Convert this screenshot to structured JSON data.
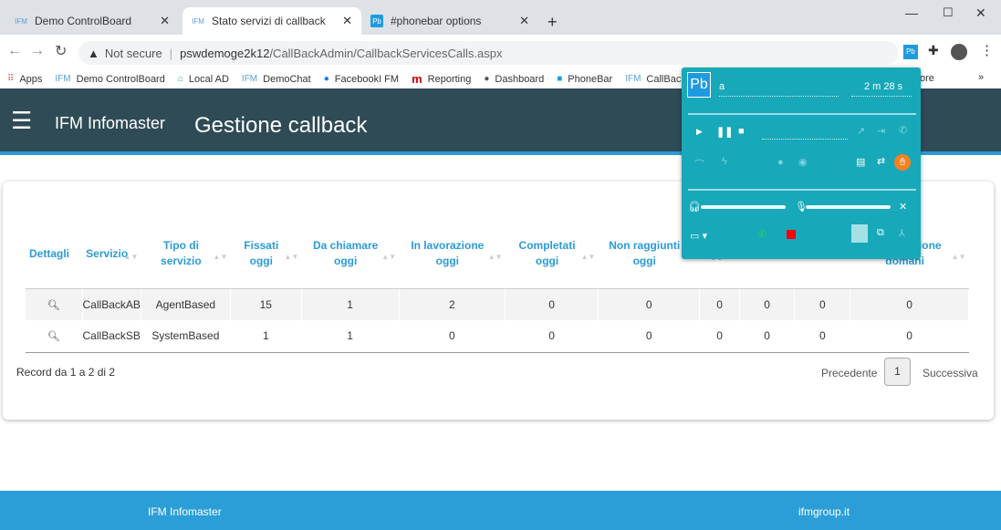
{
  "browser": {
    "tabs": [
      {
        "label": "Demo ControlBoard",
        "icon": "ifm-favicon"
      },
      {
        "label": "Stato servizi di callback",
        "icon": "ifm-favicon",
        "active": true
      },
      {
        "label": "#phonebar options",
        "icon": "pb-favicon"
      }
    ],
    "security": "Not secure",
    "url_host": "pswdemoge2k12",
    "url_path": "/CallBackAdmin/CallbackServicesCalls.aspx",
    "bookmarks": [
      {
        "label": "Apps",
        "icon": "grid-icon"
      },
      {
        "label": "Demo ControlBoard",
        "icon": "ifm-icon"
      },
      {
        "label": "Local AD",
        "icon": "home-icon"
      },
      {
        "label": "DemoChat",
        "icon": "ifm-icon"
      },
      {
        "label": "FacebookI FM",
        "icon": "facebook-icon"
      },
      {
        "label": "Reporting",
        "icon": "m-icon"
      },
      {
        "label": "Dashboard",
        "icon": "globe-icon"
      },
      {
        "label": "PhoneBar",
        "icon": "phonebar-icon"
      },
      {
        "label": "CallBackAdmin",
        "icon": "ifm-icon"
      }
    ],
    "bookmarks_more": "ore"
  },
  "header": {
    "logo": "IFM Infomaster",
    "title": "Gestione callback"
  },
  "table": {
    "columns": [
      "Dettagli",
      "Servizio",
      "Tipo di servizio",
      "Fissati oggi",
      "Da chiamare oggi",
      "In lavorazione oggi",
      "Completati oggi",
      "Non raggiunti oggi",
      "oggi",
      "domani",
      "domani",
      "In lavorazione domani"
    ],
    "rows": [
      [
        "CallBackAB",
        "AgentBased",
        "15",
        "1",
        "2",
        "0",
        "0",
        "0",
        "0",
        "0",
        "0"
      ],
      [
        "CallBackSB",
        "SystemBased",
        "1",
        "1",
        "0",
        "0",
        "0",
        "0",
        "0",
        "0",
        "0"
      ]
    ]
  },
  "pagination": {
    "info": "Record da 1 a 2 di 2",
    "prev": "Precedente",
    "page": "1",
    "next": "Successiva"
  },
  "footer": {
    "left": "IFM Infomaster",
    "right": "ifmgroup.it"
  },
  "phonebar": {
    "logo": "Pb",
    "agent": "a",
    "timer": "2 m 28 s",
    "accent": "#17a9b9",
    "hand_color": "#f5821f"
  }
}
